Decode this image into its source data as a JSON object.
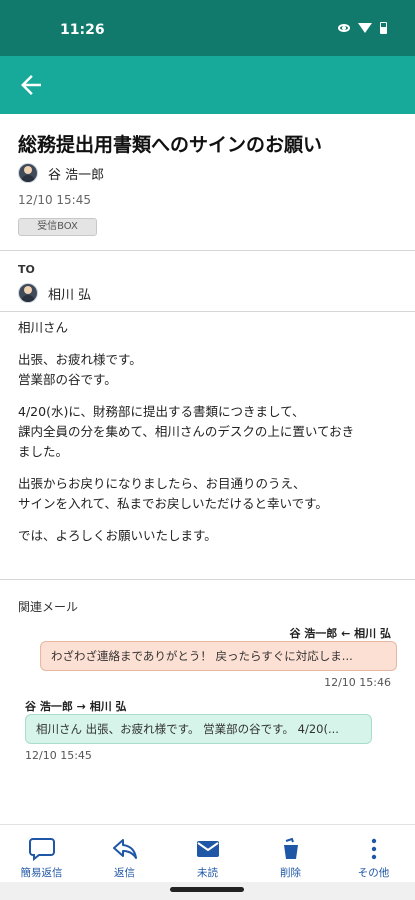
{
  "status_bar": {
    "time": "11:26"
  },
  "header": {
    "back_icon": "arrow-left-icon",
    "accent": "#17a99a"
  },
  "mail": {
    "subject": "総務提出用書類へのサインのお願い",
    "sender": "谷 浩一郎",
    "datetime": "12/10 15:45",
    "folder": "受信BOX",
    "to_label": "TO",
    "recipient": "相川 弘",
    "body": [
      "相川さん",
      "出張、お疲れ様です。\n営業部の谷です。",
      "4/20(水)に、財務部に提出する書類につきまして、\n課内全員の分を集めて、相川さんのデスクの上に置いておき\nました。",
      "出張からお戻りになりましたら、お目通りのうえ、\nサインを入れて、私までお戻しいただけると幸いです。",
      "では、よろしくお願いいたします。"
    ]
  },
  "related": {
    "label": "関連メール",
    "outgoing": {
      "header": "谷 浩一郎 ← 相川 弘",
      "snippet": "わざわざ連絡までありがとう！ 戻ったらすぐに対応しま...",
      "time": "12/10 15:46",
      "color": "#fde0d4"
    },
    "incoming": {
      "header": "谷 浩一郎 → 相川 弘",
      "snippet": "相川さん 出張、お疲れ様です。 営業部の谷です。 4/20(...",
      "time": "12/10 15:45",
      "color": "#d6f4ea"
    }
  },
  "bottom_nav": [
    {
      "label": "簡易返信",
      "icon": "speech-bubble-icon"
    },
    {
      "label": "返信",
      "icon": "reply-icon"
    },
    {
      "label": "未読",
      "icon": "envelope-icon"
    },
    {
      "label": "削除",
      "icon": "trash-icon"
    },
    {
      "label": "その他",
      "icon": "more-vert-icon"
    }
  ]
}
